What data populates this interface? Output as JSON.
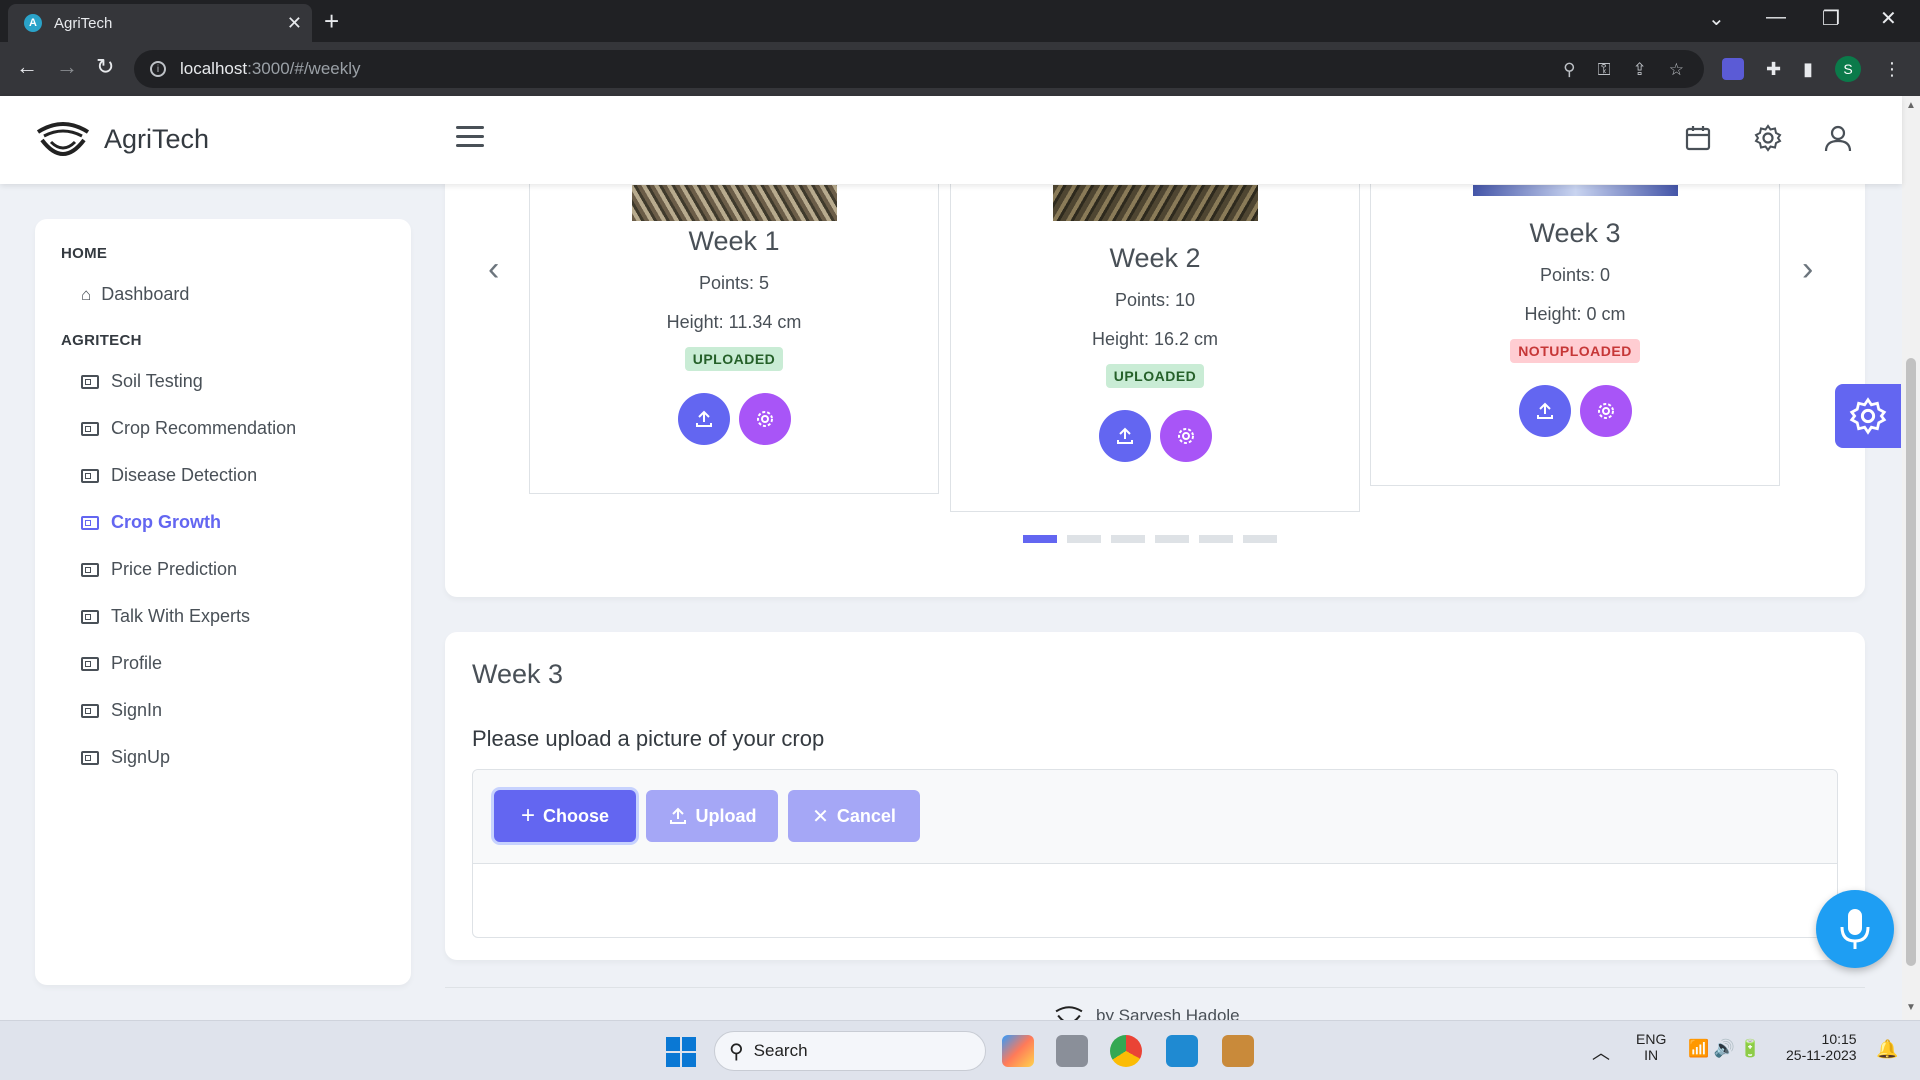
{
  "browser": {
    "tab_title": "AgriTech",
    "url_host": "localhost",
    "url_path": ":3000/#/weekly",
    "profile_initial": "S"
  },
  "header": {
    "brand": "AgriTech"
  },
  "sidebar": {
    "sections": [
      {
        "label": "HOME",
        "items": [
          {
            "label": "Dashboard",
            "icon": "home-icon"
          }
        ]
      },
      {
        "label": "AGRITECH",
        "items": [
          {
            "label": "Soil Testing",
            "icon": "id-card-icon"
          },
          {
            "label": "Crop Recommendation",
            "icon": "id-card-icon"
          },
          {
            "label": "Disease Detection",
            "icon": "id-card-icon"
          },
          {
            "label": "Crop Growth",
            "icon": "id-card-icon",
            "active": true
          },
          {
            "label": "Price Prediction",
            "icon": "id-card-icon"
          },
          {
            "label": "Talk With Experts",
            "icon": "id-card-icon"
          },
          {
            "label": "Profile",
            "icon": "id-card-icon"
          },
          {
            "label": "SignIn",
            "icon": "id-card-icon"
          },
          {
            "label": "SignUp",
            "icon": "id-card-icon"
          }
        ]
      }
    ]
  },
  "weeks": [
    {
      "title": "Week 1",
      "points": "Points: 5",
      "height": "Height: 11.34 cm",
      "status": "UPLOADED"
    },
    {
      "title": "Week 2",
      "points": "Points: 10",
      "height": "Height: 16.2 cm",
      "status": "UPLOADED"
    },
    {
      "title": "Week 3",
      "points": "Points: 0",
      "height": "Height: 0 cm",
      "status": "NOTUPLOADED"
    }
  ],
  "carousel": {
    "page_count": 6,
    "active_page": 1
  },
  "upload": {
    "heading": "Week 3",
    "instruction": "Please upload a picture of your crop",
    "choose_label": "Choose",
    "upload_label": "Upload",
    "cancel_label": "Cancel"
  },
  "footer": {
    "text": "by  Sarvesh Hadole"
  },
  "taskbar": {
    "search_label": "Search",
    "lang_top": "ENG",
    "lang_bottom": "IN",
    "time": "10:15",
    "date": "25-11-2023"
  },
  "colors": {
    "primary": "#6366f1",
    "secondary": "#a855f7",
    "mic": "#1e9ef3"
  }
}
